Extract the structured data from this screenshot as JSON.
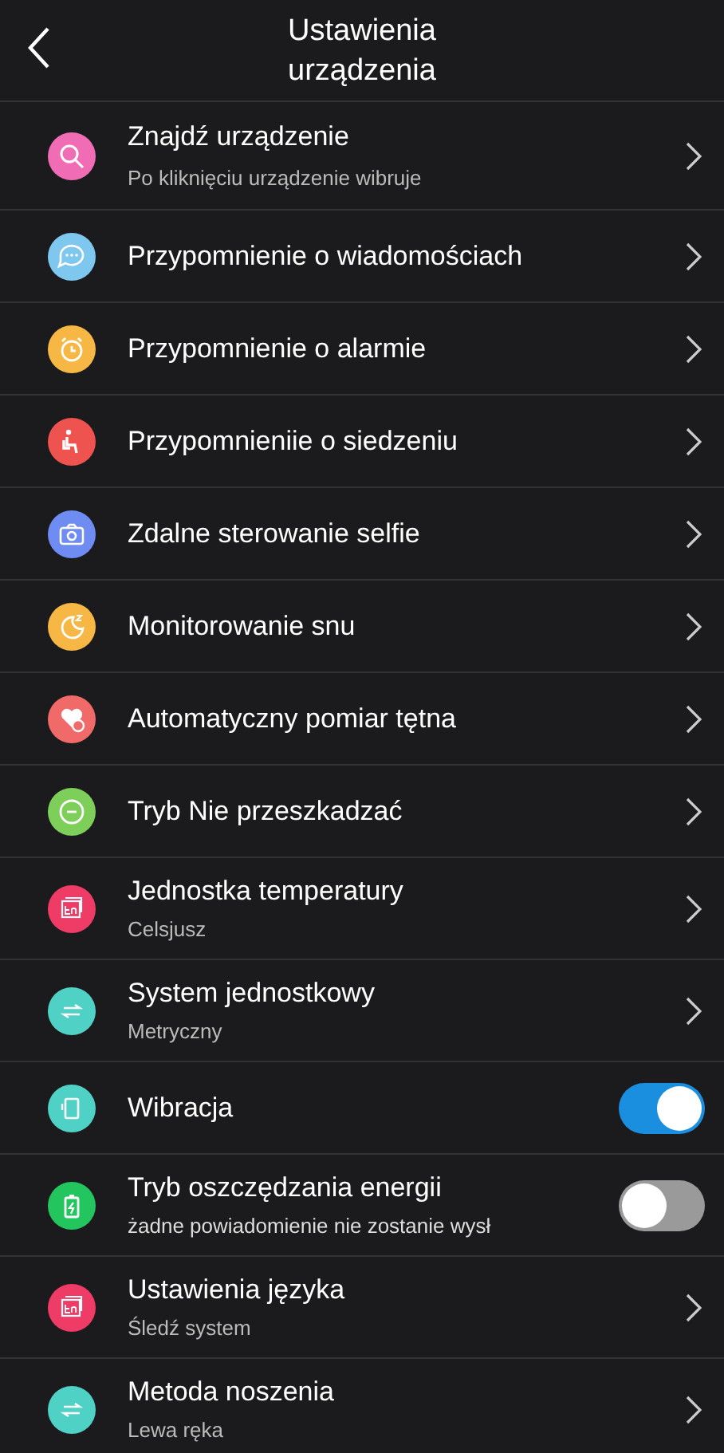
{
  "header": {
    "title": "Ustawienia urządzenia"
  },
  "items": [
    {
      "kind": "link",
      "color": "#f06db5",
      "title": "Znajdź urządzenie",
      "subtitle": "Po kliknięciu urządzenie wibruje"
    },
    {
      "kind": "link",
      "color": "#7ec8ef",
      "title": "Przypomnienie o wiadomościach"
    },
    {
      "kind": "link",
      "color": "#f7b744",
      "title": "Przypomnienie o alarmie"
    },
    {
      "kind": "link",
      "color": "#ef5350",
      "title": "Przypomnieniie o siedzeniu"
    },
    {
      "kind": "link",
      "color": "#6f8cf2",
      "title": "Zdalne sterowanie selfie"
    },
    {
      "kind": "link",
      "color": "#f7b744",
      "title": "Monitorowanie snu"
    },
    {
      "kind": "link",
      "color": "#f06a6a",
      "title": "Automatyczny pomiar tętna"
    },
    {
      "kind": "link",
      "color": "#7dcf5a",
      "title": "Tryb Nie przeszkadzać"
    },
    {
      "kind": "link",
      "color": "#ef3c67",
      "title": "Jednostka temperatury",
      "subtitle": "Celsjusz"
    },
    {
      "kind": "link",
      "color": "#4fd1c5",
      "title": "System jednostkowy",
      "subtitle": "Metryczny"
    },
    {
      "kind": "toggle",
      "color": "#4fd1c5",
      "title": "Wibracja",
      "on": true
    },
    {
      "kind": "toggle",
      "color": "#22c55e",
      "title": "Tryb oszczędzania energii",
      "subtitle": "żadne powiadomienie nie zostanie wysł",
      "on": false
    },
    {
      "kind": "link",
      "color": "#ef3c67",
      "title": "Ustawienia języka",
      "subtitle": "Śledź system"
    },
    {
      "kind": "link",
      "color": "#4fd1c5",
      "title": "Metoda noszenia",
      "subtitle": "Lewa ręka"
    }
  ]
}
